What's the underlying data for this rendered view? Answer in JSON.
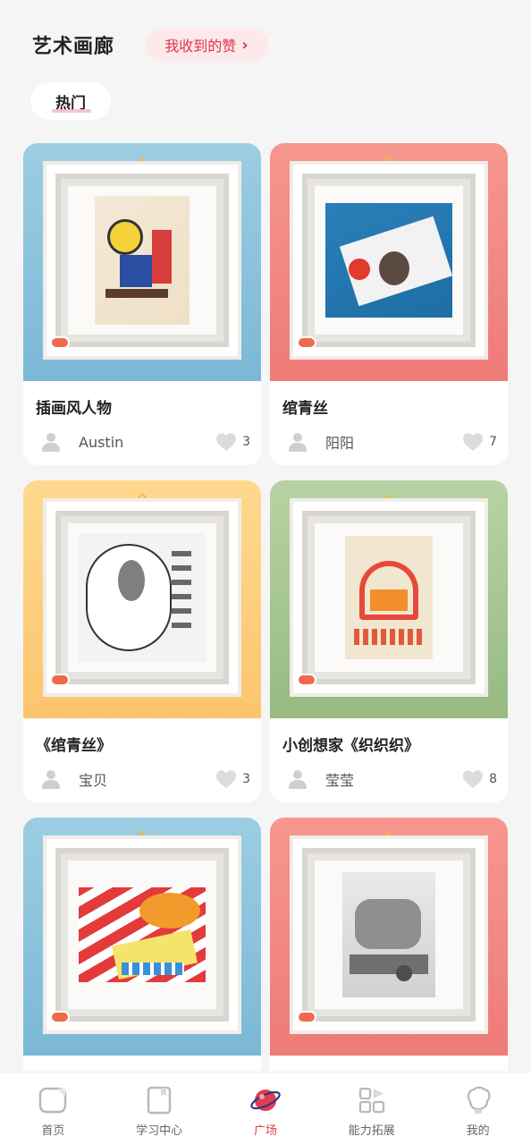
{
  "header": {
    "title": "艺术画廊",
    "likes_received": "我收到的赞",
    "tag": "热门"
  },
  "colors": {
    "accent": "#e23c4e",
    "blue_card": "#8cc4df",
    "pink_card": "#f3867f",
    "yellow_card": "#ffd07d",
    "green_card": "#a7c890"
  },
  "artworks": [
    {
      "name": "插画风人物",
      "author": "Austin",
      "likes": "3",
      "theme": "blue"
    },
    {
      "name": "绾青丝",
      "author": "阳阳",
      "likes": "7",
      "theme": "pink"
    },
    {
      "name": "《绾青丝》",
      "author": "宝贝",
      "likes": "3",
      "theme": "yellow"
    },
    {
      "name": "小创想家《织织织》",
      "author": "莹莹",
      "likes": "8",
      "theme": "green"
    },
    {
      "name": "",
      "author": "",
      "likes": "",
      "theme": "blue"
    },
    {
      "name": "",
      "author": "",
      "likes": "",
      "theme": "pink"
    }
  ],
  "tabbar": [
    {
      "label": "首页",
      "icon": "home-icon"
    },
    {
      "label": "学习中心",
      "icon": "book-icon"
    },
    {
      "label": "广场",
      "icon": "planet-icon",
      "active": true
    },
    {
      "label": "能力拓展",
      "icon": "grid-icon"
    },
    {
      "label": "我的",
      "icon": "profile-icon"
    }
  ]
}
